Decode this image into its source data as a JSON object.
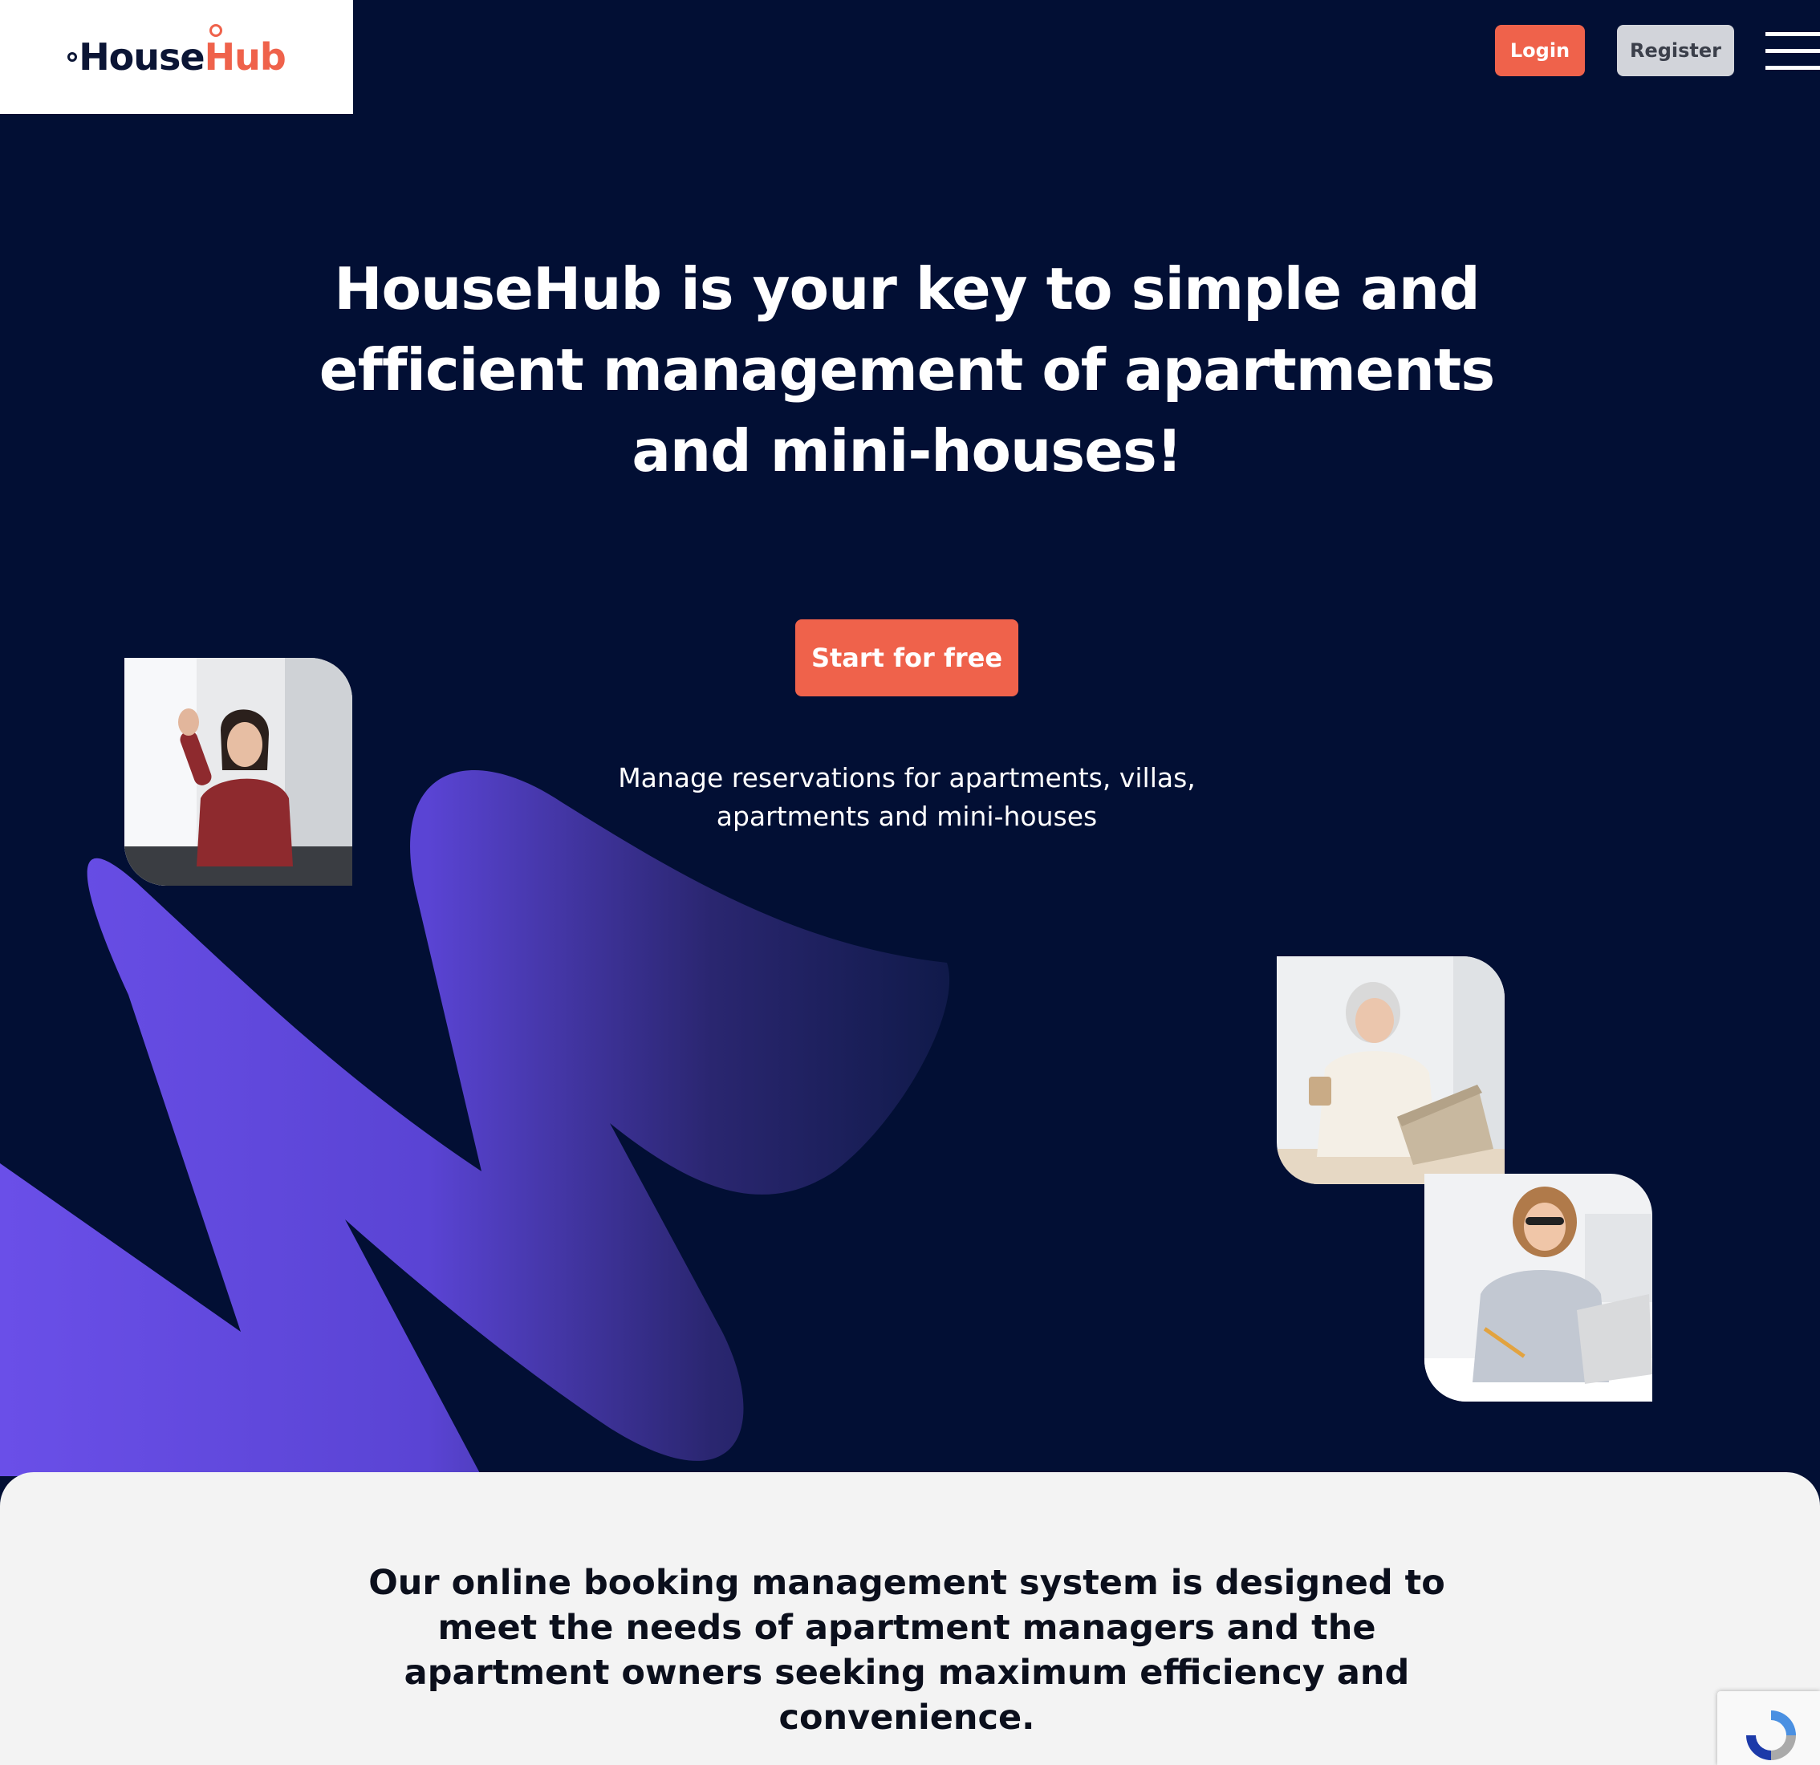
{
  "header": {
    "logo": {
      "prefix": "House",
      "accent": "Hub"
    },
    "login_label": "Login",
    "register_label": "Register",
    "menu_icon": "hamburger-menu-icon"
  },
  "hero": {
    "title": "HouseHub is your key to simple and efficient management of apartments and mini-houses!",
    "cta_label": "Start for free",
    "subtitle": "Manage reservations for apartments, villas, apartments and mini-houses"
  },
  "intro": {
    "text": "Our online booking management system is designed to meet the needs of apartment managers and the apartment owners seeking maximum efficiency and convenience."
  },
  "recaptcha": {
    "icon": "recaptcha-icon"
  },
  "colors": {
    "background": "#020f34",
    "accent": "#ef624b",
    "swoosh": "#6a4fe8",
    "light_section": "#f3f3f3"
  }
}
